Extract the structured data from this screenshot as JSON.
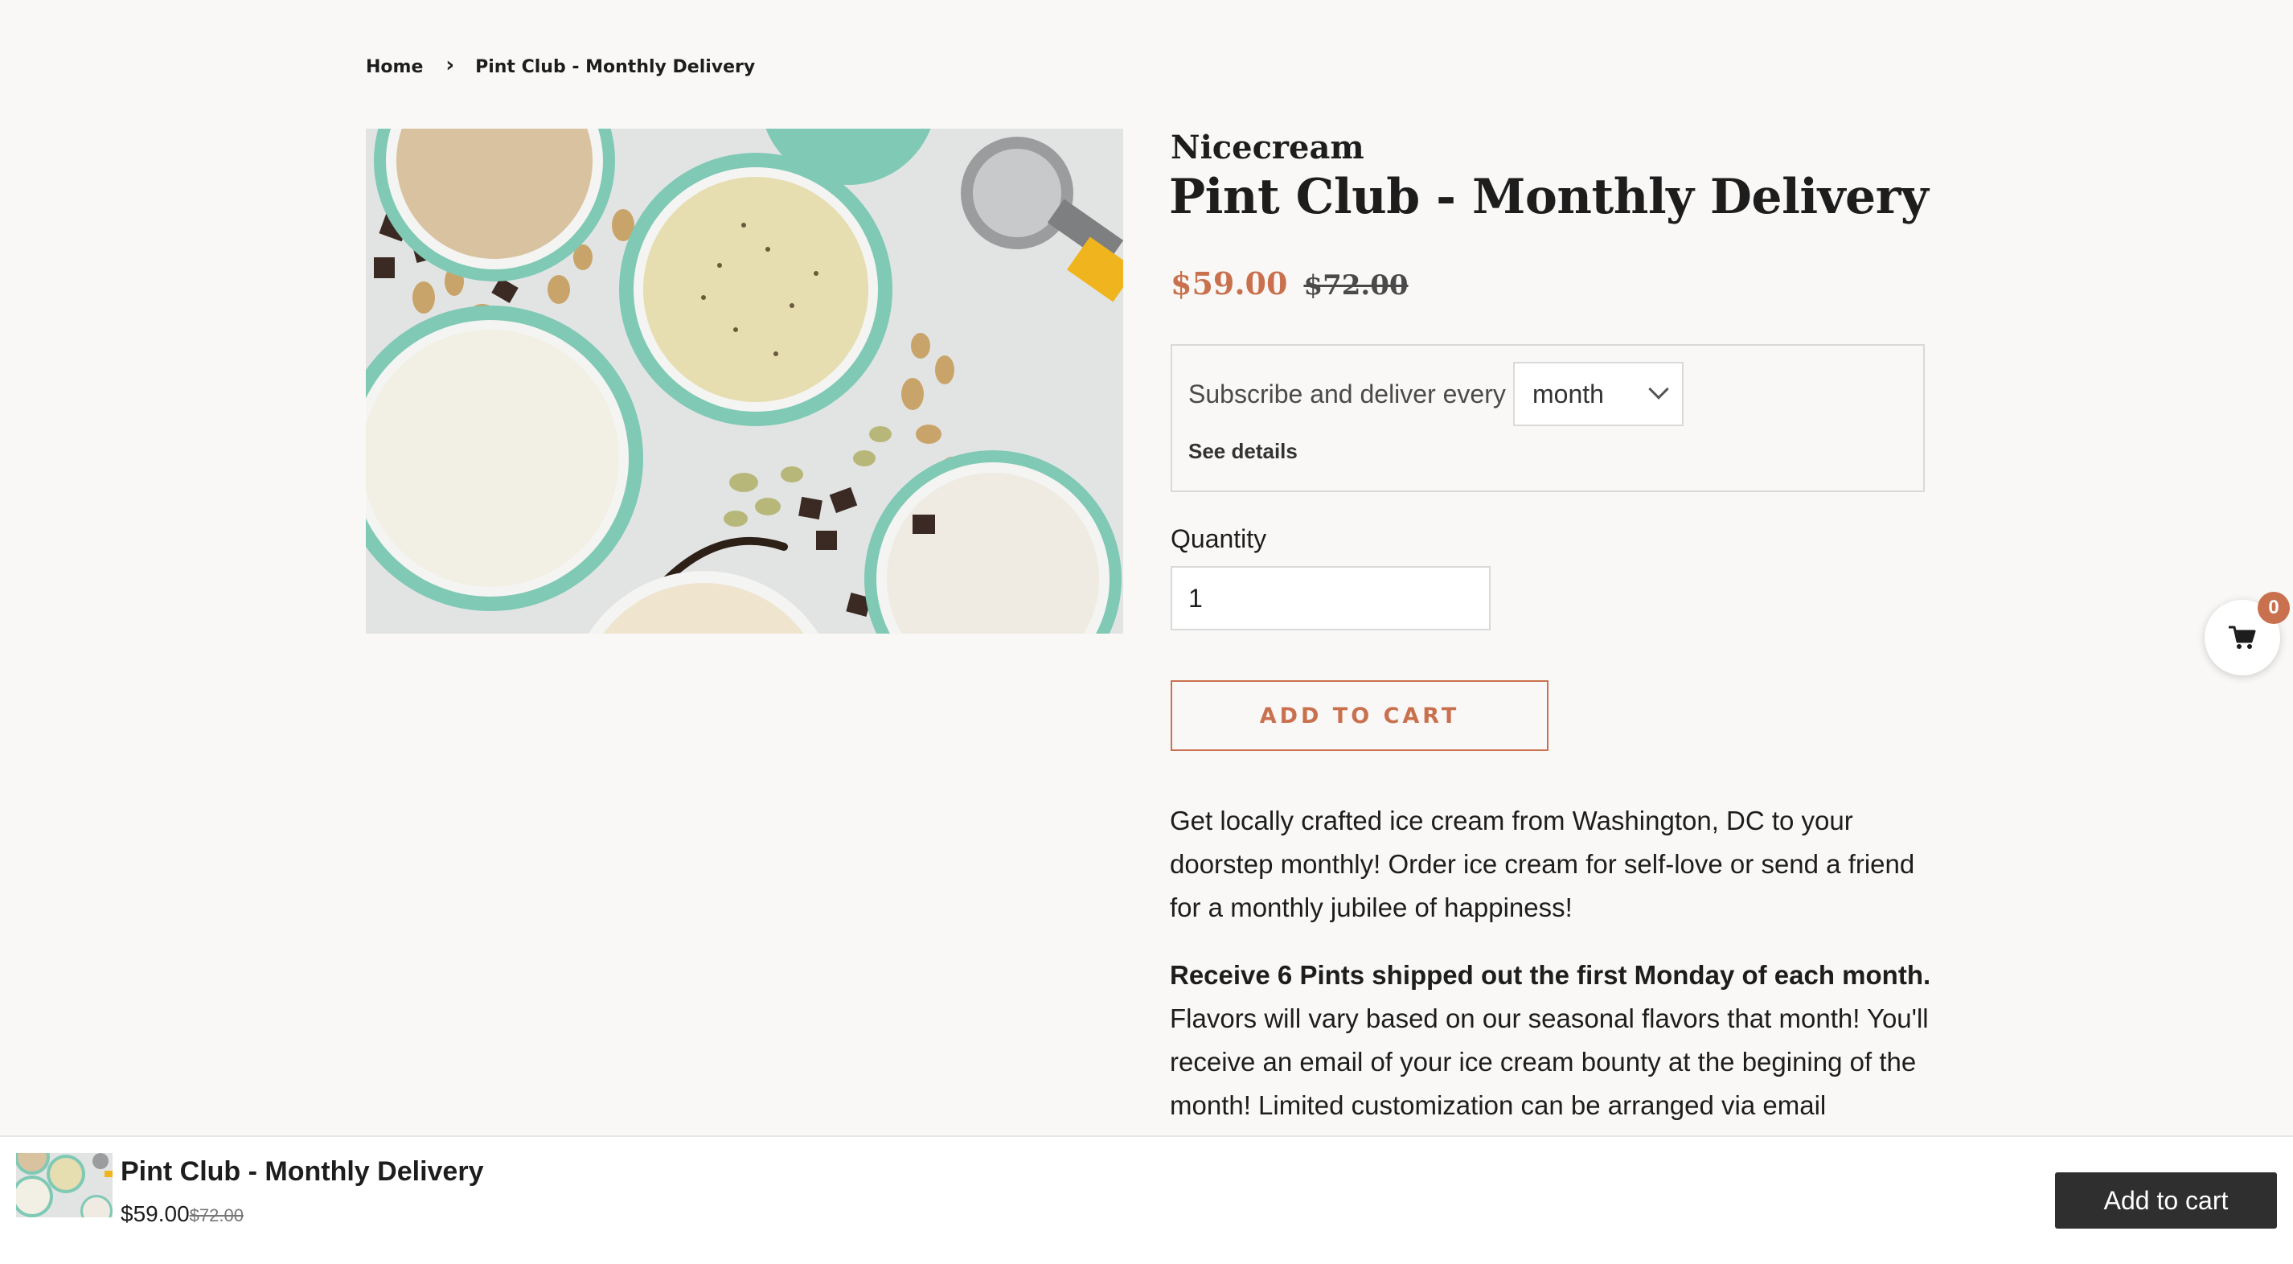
{
  "breadcrumb": {
    "home": "Home",
    "separator": "›",
    "current": "Pint Club - Monthly Delivery"
  },
  "product": {
    "vendor": "Nicecream",
    "title": "Pint Club - Monthly Delivery",
    "price": "$59.00",
    "compare_price": "$72.00",
    "image_icon": "ice-cream-pints-photo"
  },
  "subscription": {
    "label": "Subscribe and deliver every",
    "frequency": "month",
    "details_link": "See details"
  },
  "quantity": {
    "label": "Quantity",
    "value": "1"
  },
  "add_to_cart": {
    "label": "ADD TO CART"
  },
  "description": {
    "intro": "Get locally crafted ice cream from Washington, DC to your doorstep monthly! Order ice cream for self-love or send a friend for a monthly jubilee of happiness!",
    "bold": "Receive 6 Pints shipped out the first Monday of each month.",
    "rest": "Flavors will vary based on our seasonal flavors that month! You'll receive an email of your ice cream bounty at the begining of the month! Limited customization can be arranged via email"
  },
  "cart": {
    "count": "0",
    "icon": "cart-icon"
  },
  "sticky_bar": {
    "title": "Pint Club - Monthly Delivery",
    "price": "$59.00",
    "compare_price": "$72.00",
    "button_label": "Add to cart"
  },
  "colors": {
    "accent": "#c9714e",
    "background": "#f9f8f6",
    "text": "#1d1d1d",
    "sticky_button": "#2f2f2f"
  }
}
